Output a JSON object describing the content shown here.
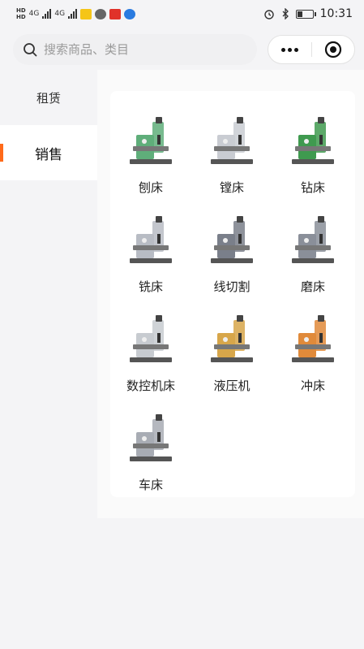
{
  "status": {
    "time": "10:31",
    "net1": "4G",
    "net2": "4G"
  },
  "search": {
    "placeholder": "搜索商品、类目"
  },
  "sidebar": {
    "items": [
      {
        "label": "租赁",
        "active": false
      },
      {
        "label": "销售",
        "active": true
      }
    ]
  },
  "products": [
    {
      "label": "刨床",
      "icon": "shaper-machine-icon",
      "color": "#5fae7a"
    },
    {
      "label": "镗床",
      "icon": "boring-machine-icon",
      "color": "#c9ccd2"
    },
    {
      "label": "钻床",
      "icon": "drill-press-icon",
      "color": "#3f9a4f"
    },
    {
      "label": "铣床",
      "icon": "milling-machine-icon",
      "color": "#b8bcc4"
    },
    {
      "label": "线切割",
      "icon": "wire-cut-machine-icon",
      "color": "#7a7f8a"
    },
    {
      "label": "磨床",
      "icon": "grinding-machine-icon",
      "color": "#8a8f99"
    },
    {
      "label": "数控机床",
      "icon": "cnc-machine-icon",
      "color": "#c7cbd0"
    },
    {
      "label": "液压机",
      "icon": "hydraulic-press-icon",
      "color": "#d7a64a"
    },
    {
      "label": "冲床",
      "icon": "punch-press-icon",
      "color": "#e08a3a"
    },
    {
      "label": "车床",
      "icon": "lathe-icon",
      "color": "#a8acb4"
    }
  ]
}
